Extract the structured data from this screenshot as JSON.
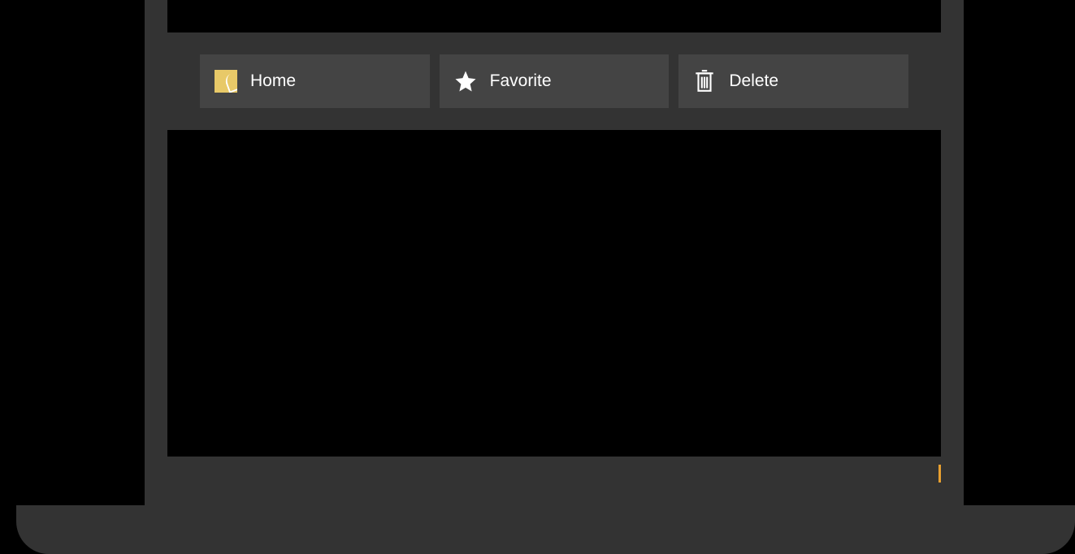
{
  "toolbar": {
    "buttons": [
      {
        "label": "Home",
        "icon": "home-icon"
      },
      {
        "label": "Favorite",
        "icon": "star-icon"
      },
      {
        "label": "Delete",
        "icon": "trash-icon"
      }
    ]
  },
  "colors": {
    "frame": "#333333",
    "button_bg": "#444444",
    "accent_yellow": "#e8c968",
    "accent_orange": "#e8a030"
  }
}
